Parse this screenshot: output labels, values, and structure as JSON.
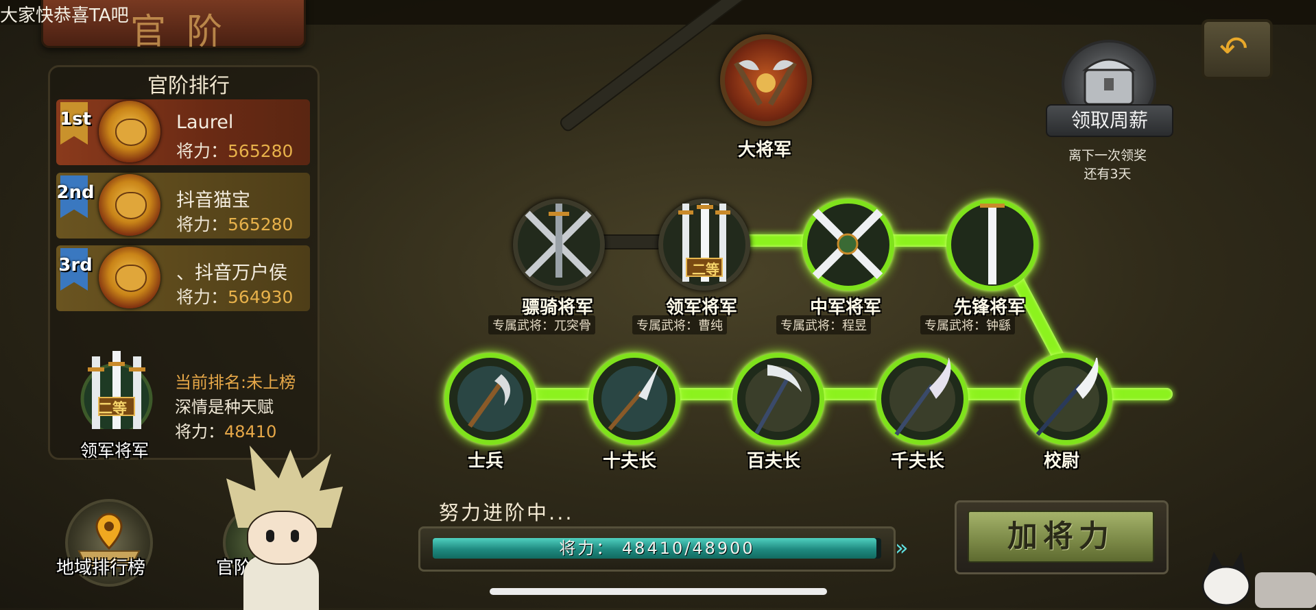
{
  "top_caption": "大家快恭喜TA吧",
  "page_title": "官阶",
  "ranking": {
    "title": "官阶排行",
    "power_label": "将力：",
    "entries": [
      {
        "badge": "1st",
        "name": "Laurel",
        "power": "565280"
      },
      {
        "badge": "2nd",
        "name": "抖音猫宝",
        "power": "565280"
      },
      {
        "badge": "3rd",
        "name": "、抖音万户侯",
        "power": "564930"
      }
    ],
    "my": {
      "rank_text": "当前排名:未上榜",
      "name": "深情是种天赋",
      "power_label": "将力：",
      "power": "48410",
      "title": "领军将军",
      "tier_tag": "二等"
    }
  },
  "bottom_buttons": {
    "region_rank": "地域排行榜",
    "rank_up": "官阶进"
  },
  "ranks": {
    "top": {
      "name": "大将军"
    },
    "upper": [
      {
        "name": "骠骑将军",
        "exclusive": "专属武将：兀突骨"
      },
      {
        "name": "领军将军",
        "exclusive": "专属武将：曹纯",
        "tag": "二等"
      },
      {
        "name": "中军将军",
        "exclusive": "专属武将：程昱"
      },
      {
        "name": "先锋将军",
        "exclusive": "专属武将：钟繇"
      }
    ],
    "lower": [
      {
        "name": "士兵"
      },
      {
        "name": "十夫长"
      },
      {
        "name": "百夫长"
      },
      {
        "name": "千夫长"
      },
      {
        "name": "校尉"
      }
    ]
  },
  "salary": {
    "button": "领取周薪",
    "note_line1": "离下一次领奖",
    "note_line2": "还有3天"
  },
  "progress": {
    "caption": "努力进阶中...",
    "text": "将力： 48410/48900",
    "current": 48410,
    "target": 48900
  },
  "add_power_button": "加将力",
  "colors": {
    "glow_green": "#8cf21e",
    "power_orange": "#e7b14a",
    "progress_teal": "#1f8a80"
  },
  "icons": [
    "lion-head-icon",
    "back-arrow-icon",
    "treasure-chest-icon",
    "map-pin-icon",
    "sword-icon",
    "axe-icon",
    "glaive-icon",
    "pickaxe-icon"
  ]
}
